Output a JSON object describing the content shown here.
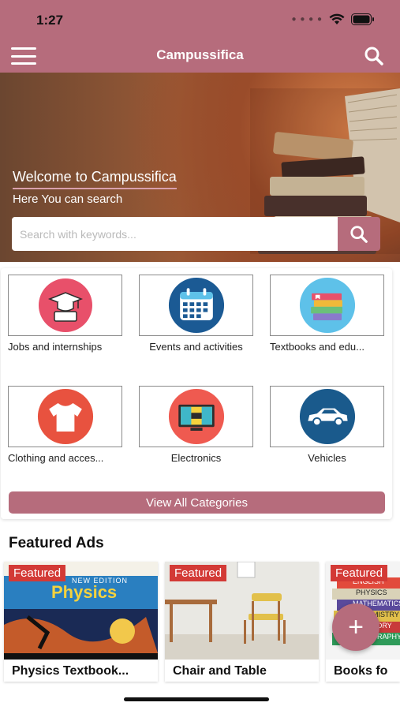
{
  "status": {
    "time": "1:27"
  },
  "appbar": {
    "title": "Campussifica",
    "menu_icon": "hamburger-icon",
    "search_icon": "search-icon"
  },
  "hero": {
    "welcome": "Welcome to Campussifica",
    "subtitle": "Here You can search",
    "search_placeholder": "Search with keywords..."
  },
  "categories": [
    {
      "label": "Jobs and internships",
      "icon": "graduation-icon",
      "color": "#e8506a"
    },
    {
      "label": "Events and activities",
      "icon": "calendar-icon",
      "color": "#1b5a94"
    },
    {
      "label": "Textbooks and edu...",
      "icon": "books-icon",
      "color": "#5ec1e9"
    },
    {
      "label": "Clothing and acces...",
      "icon": "tshirt-icon",
      "color": "#e8523f"
    },
    {
      "label": "Electronics",
      "icon": "tv-icon",
      "color": "#ef5a50"
    },
    {
      "label": "Vehicles",
      "icon": "car-icon",
      "color": "#1a5a8c"
    }
  ],
  "view_all_label": "View All Categories",
  "featured": {
    "title": "Featured Ads",
    "items": [
      {
        "badge": "Featured",
        "title": "Physics Textbook...",
        "cover_text": "Physics",
        "cover_sub": "NEW EDITION"
      },
      {
        "badge": "Featured",
        "title": "Chair and Table"
      },
      {
        "badge": "Featured",
        "title": "Books fo",
        "spines": [
          "ENGLISH",
          "PHYSICS",
          "MATHEMATICS",
          "CHEMISTRY",
          "HISTORY",
          "GEOGRAPHY"
        ]
      }
    ]
  },
  "fab": {
    "label": "+"
  },
  "colors": {
    "brand": "#b66c7c",
    "badge": "#d33a36"
  }
}
